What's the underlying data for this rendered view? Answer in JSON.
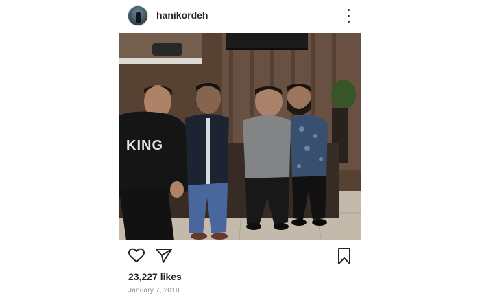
{
  "post": {
    "username": "hanikordeh",
    "likes": "23,227 likes",
    "date": "January 7, 2018",
    "shirt_text": "KING"
  },
  "icons": {
    "avatar": "avatar",
    "more": "more-vertical-icon",
    "like": "heart-icon",
    "share": "paper-plane-icon",
    "save": "bookmark-icon"
  }
}
